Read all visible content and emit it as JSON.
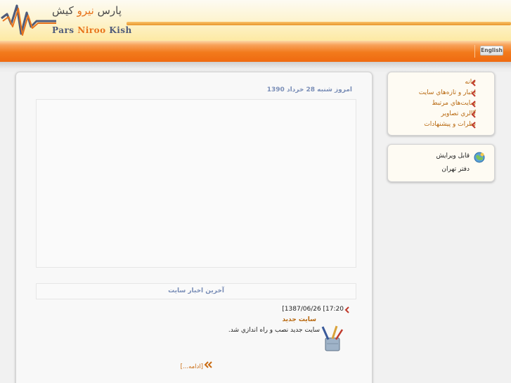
{
  "header": {
    "logo_fa_part1": "پارس",
    "logo_fa_part2": "نیرو",
    "logo_fa_part3": "کیش",
    "logo_en_part1": "Pars",
    "logo_en_part2": "Niroo",
    "logo_en_part3": "Kish"
  },
  "nav": {
    "language_button": "English"
  },
  "main": {
    "date_text": "امروز شنبه 28 خرداد 1390",
    "news_header": "آخرين اخبار سايت",
    "news": {
      "time": "[1387/06/26 [17:20",
      "title": "سايت جديد",
      "body": "سايت جديد نصب و راه اندازي شد.",
      "more": "[ادامه...]"
    }
  },
  "sidebar": {
    "menu": [
      {
        "label": "خانه"
      },
      {
        "label": "اخبار و تازه‌هاي سايت"
      },
      {
        "label": "سايت‌هاي مرتبط"
      },
      {
        "label": "گالري تصاوير"
      },
      {
        "label": "نظرات و پيشنهادات"
      }
    ],
    "links": [
      {
        "label": "قابل ويرايش"
      },
      {
        "label": "دفتر تهران"
      }
    ]
  },
  "colors": {
    "accent_orange": "#ef6a10",
    "link_brown": "#b8680f",
    "heading_blue": "#7a8eb7",
    "chevron_red": "#c0392b"
  },
  "icons": [
    "logo-mark",
    "chevron-left-icon",
    "pencil-cup-icon",
    "double-chevron-icon",
    "globe-icon"
  ]
}
